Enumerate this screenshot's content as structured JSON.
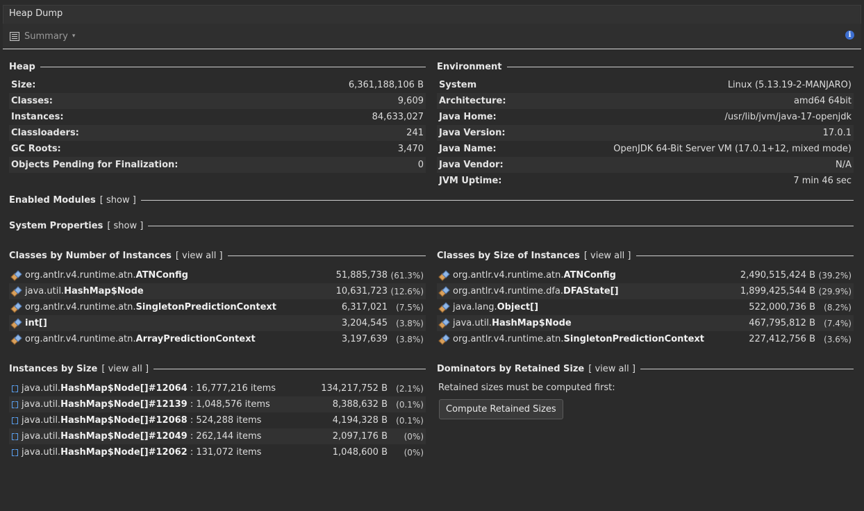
{
  "window": {
    "title": "Heap Dump"
  },
  "view": {
    "selector_label": "Summary"
  },
  "heap": {
    "title": "Heap",
    "rows": [
      {
        "key": "Size:",
        "value": "6,361,188,106 B"
      },
      {
        "key": "Classes:",
        "value": "9,609"
      },
      {
        "key": "Instances:",
        "value": "84,633,027"
      },
      {
        "key": "Classloaders:",
        "value": "241"
      },
      {
        "key": "GC Roots:",
        "value": "3,470"
      },
      {
        "key": "Objects Pending for Finalization:",
        "value": "0"
      }
    ]
  },
  "environment": {
    "title": "Environment",
    "rows": [
      {
        "key": "System",
        "value": "Linux (5.13.19-2-MANJARO)"
      },
      {
        "key": "Architecture:",
        "value": "amd64 64bit"
      },
      {
        "key": "Java Home:",
        "value": "/usr/lib/jvm/java-17-openjdk"
      },
      {
        "key": "Java Version:",
        "value": "17.0.1"
      },
      {
        "key": "Java Name:",
        "value": "OpenJDK 64-Bit Server VM (17.0.1+12, mixed mode)"
      },
      {
        "key": "Java Vendor:",
        "value": "N/A"
      },
      {
        "key": "JVM Uptime:",
        "value": "7 min 46 sec"
      }
    ]
  },
  "modules": {
    "title": "Enabled Modules",
    "link": "show"
  },
  "sysprops": {
    "title": "System Properties",
    "link": "show"
  },
  "by_count": {
    "title": "Classes by Number of Instances",
    "link": "view all",
    "rows": [
      {
        "pkg": "org.antlr.v4.runtime.atn.",
        "name": "ATNConfig",
        "count": "51,885,738",
        "pct": "(61.3%)"
      },
      {
        "pkg": "java.util.",
        "name": "HashMap$Node",
        "count": "10,631,723",
        "pct": "(12.6%)"
      },
      {
        "pkg": "org.antlr.v4.runtime.atn.",
        "name": "SingletonPredictionContext",
        "count": "6,317,021",
        "pct": "(7.5%)"
      },
      {
        "pkg": "",
        "name": "int[]",
        "count": "3,204,545",
        "pct": "(3.8%)"
      },
      {
        "pkg": "org.antlr.v4.runtime.atn.",
        "name": "ArrayPredictionContext",
        "count": "3,197,639",
        "pct": "(3.8%)"
      }
    ]
  },
  "by_size": {
    "title": "Classes by Size of Instances",
    "link": "view all",
    "rows": [
      {
        "pkg": "org.antlr.v4.runtime.atn.",
        "name": "ATNConfig",
        "size": "2,490,515,424 B",
        "pct": "(39.2%)"
      },
      {
        "pkg": "org.antlr.v4.runtime.dfa.",
        "name": "DFAState[]",
        "size": "1,899,425,544 B",
        "pct": "(29.9%)"
      },
      {
        "pkg": "java.lang.",
        "name": "Object[]",
        "size": "522,000,736 B",
        "pct": "(8.2%)"
      },
      {
        "pkg": "java.util.",
        "name": "HashMap$Node",
        "size": "467,795,812 B",
        "pct": "(7.4%)"
      },
      {
        "pkg": "org.antlr.v4.runtime.atn.",
        "name": "SingletonPredictionContext",
        "size": "227,412,756 B",
        "pct": "(3.6%)"
      }
    ]
  },
  "instances": {
    "title": "Instances by Size",
    "link": "view all",
    "rows": [
      {
        "pkg": "java.util.",
        "name": "HashMap$Node[]#12064",
        "items": " : 16,777,216 items",
        "size": "134,217,752 B",
        "pct": "(2.1%)"
      },
      {
        "pkg": "java.util.",
        "name": "HashMap$Node[]#12139",
        "items": " : 1,048,576 items",
        "size": "8,388,632 B",
        "pct": "(0.1%)"
      },
      {
        "pkg": "java.util.",
        "name": "HashMap$Node[]#12068",
        "items": " : 524,288 items",
        "size": "4,194,328 B",
        "pct": "(0.1%)"
      },
      {
        "pkg": "java.util.",
        "name": "HashMap$Node[]#12049",
        "items": " : 262,144 items",
        "size": "2,097,176 B",
        "pct": "(0%)"
      },
      {
        "pkg": "java.util.",
        "name": "HashMap$Node[]#12062",
        "items": " : 131,072 items",
        "size": "1,048,600 B",
        "pct": "(0%)"
      }
    ]
  },
  "dominators": {
    "title": "Dominators by Retained Size",
    "link": "view all",
    "message": "Retained sizes must be computed first:",
    "button": "Compute Retained Sizes"
  }
}
